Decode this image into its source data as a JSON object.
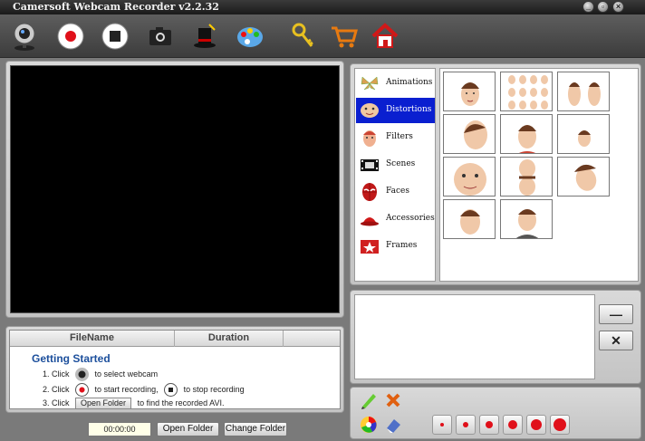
{
  "window": {
    "title": "Camersoft Webcam Recorder v2.2.32"
  },
  "toolbar": {
    "items": [
      "webcam-icon",
      "record-icon",
      "stop-icon",
      "camera-icon",
      "magic-hat-icon",
      "palette-icon",
      "keys-icon",
      "cart-icon",
      "home-icon"
    ]
  },
  "file_list": {
    "columns": [
      "FileName",
      "Duration"
    ],
    "getting_started": "Getting  Started",
    "step1_prefix": "1. Click",
    "step1_suffix": "to select webcam",
    "step2_prefix": "2. Click",
    "step2_middle": "to start recording,",
    "step2_suffix": "to stop recording",
    "step3_prefix": "3. Click",
    "step3_button": "Open Folder",
    "step3_suffix": "to find the recorded AVI."
  },
  "bottom_bar": {
    "time": "00:00:00",
    "open_folder": "Open Folder",
    "change_folder": "Change Folder"
  },
  "effects": {
    "categories": [
      "Animations",
      "Distortions",
      "Filters",
      "Scenes",
      "Faces",
      "Accessories",
      "Frames"
    ],
    "selected_category": "Distortions"
  },
  "props": {
    "minus_label": "—",
    "close_label": "✕"
  },
  "colors": {
    "selection": "#0a1fd0",
    "record_red": "#e0101a",
    "heading_blue": "#1c4f9c"
  }
}
